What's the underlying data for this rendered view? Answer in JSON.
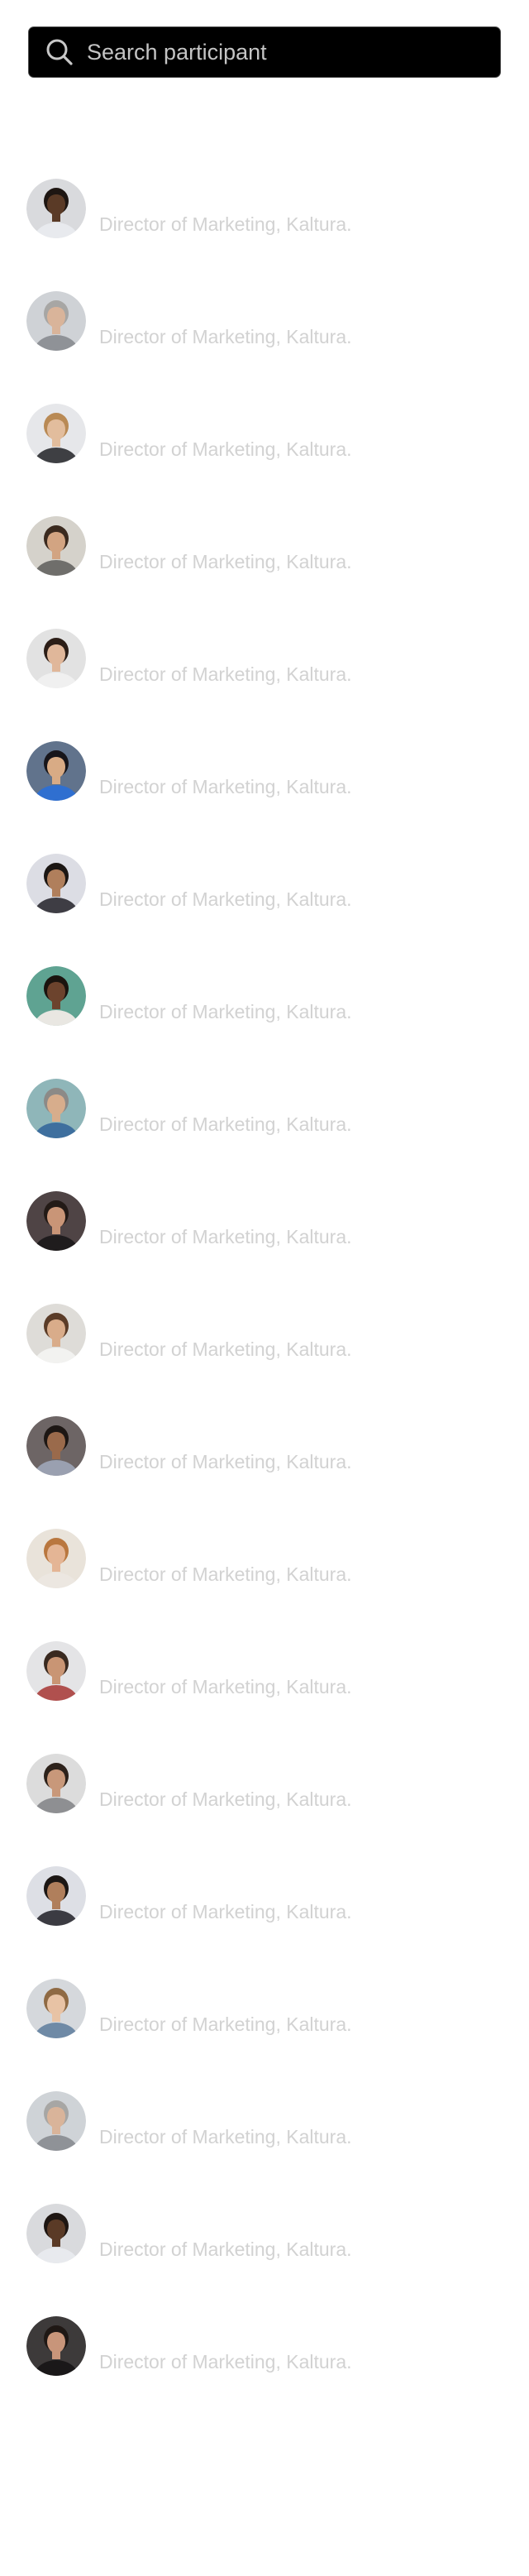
{
  "search": {
    "placeholder": "Search participant",
    "icon": "search-icon"
  },
  "colors": {
    "search_background": "#000000",
    "search_border": "#4a4a4a",
    "placeholder_text": "#c4c4c4",
    "participant_text": "#d2d2d2",
    "page_background": "#ffffff"
  },
  "participants": [
    {
      "title": "Director of Marketing, Kaltura.",
      "avatar": {
        "bg": "#d9dadd",
        "skin": "#5a3a26",
        "hair": "#1e1612",
        "shirt": "#e8eaee"
      }
    },
    {
      "title": "Director of Marketing, Kaltura.",
      "avatar": {
        "bg": "#cfd2d6",
        "skin": "#d9b49a",
        "hair": "#a7a6a4",
        "shirt": "#8f9297"
      }
    },
    {
      "title": "Director of Marketing, Kaltura.",
      "avatar": {
        "bg": "#e6e7ea",
        "skin": "#e2bd9d",
        "hair": "#b98a55",
        "shirt": "#3e3f43"
      }
    },
    {
      "title": "Director of Marketing, Kaltura.",
      "avatar": {
        "bg": "#d5d2cb",
        "skin": "#d2a482",
        "hair": "#3b2a1f",
        "shirt": "#6f6e6b"
      }
    },
    {
      "title": "Director of Marketing, Kaltura.",
      "avatar": {
        "bg": "#e2e2e2",
        "skin": "#e0b79a",
        "hair": "#2c1e17",
        "shirt": "#f0f0f0"
      }
    },
    {
      "title": "Director of Marketing, Kaltura.",
      "avatar": {
        "bg": "#61738c",
        "skin": "#d8ab85",
        "hair": "#17151a",
        "shirt": "#2f6fd0"
      }
    },
    {
      "title": "Director of Marketing, Kaltura.",
      "avatar": {
        "bg": "#dcdde4",
        "skin": "#b07f5c",
        "hair": "#1c1714",
        "shirt": "#3e3d44"
      }
    },
    {
      "title": "Director of Marketing, Kaltura.",
      "avatar": {
        "bg": "#5fa392",
        "skin": "#6c432d",
        "hair": "#1b140f",
        "shirt": "#e9e7e2"
      }
    },
    {
      "title": "Director of Marketing, Kaltura.",
      "avatar": {
        "bg": "#8fb6b9",
        "skin": "#d7ad8c",
        "hair": "#8c8a87",
        "shirt": "#3e6f9e"
      }
    },
    {
      "title": "Director of Marketing, Kaltura.",
      "avatar": {
        "bg": "#4f4445",
        "skin": "#c99577",
        "hair": "#231a16",
        "shirt": "#1f1c1d"
      }
    },
    {
      "title": "Director of Marketing, Kaltura.",
      "avatar": {
        "bg": "#dedcd8",
        "skin": "#d9ac8a",
        "hair": "#5b3c28",
        "shirt": "#f2f2f0"
      }
    },
    {
      "title": "Director of Marketing, Kaltura.",
      "avatar": {
        "bg": "#6d6565",
        "skin": "#9a6a4b",
        "hair": "#1d1714",
        "shirt": "#9aa0b0"
      }
    },
    {
      "title": "Director of Marketing, Kaltura.",
      "avatar": {
        "bg": "#e9e3da",
        "skin": "#e4b595",
        "hair": "#b9773f",
        "shirt": "#ece7e1"
      }
    },
    {
      "title": "Director of Marketing, Kaltura.",
      "avatar": {
        "bg": "#e4e4e6",
        "skin": "#c99574",
        "hair": "#3a2a20",
        "shirt": "#b0504e"
      }
    },
    {
      "title": "Director of Marketing, Kaltura.",
      "avatar": {
        "bg": "#dcdcdc",
        "skin": "#c8987a",
        "hair": "#2d221b",
        "shirt": "#8e8f92"
      }
    },
    {
      "title": "Director of Marketing, Kaltura.",
      "avatar": {
        "bg": "#dddfe5",
        "skin": "#b07f5c",
        "hair": "#1c1714",
        "shirt": "#3b3b42"
      }
    },
    {
      "title": "Director of Marketing, Kaltura.",
      "avatar": {
        "bg": "#d5d8dc",
        "skin": "#e8c3a5",
        "hair": "#8f6a44",
        "shirt": "#6f8aa6"
      }
    },
    {
      "title": "Director of Marketing, Kaltura.",
      "avatar": {
        "bg": "#cfd3d7",
        "skin": "#d9b49a",
        "hair": "#a7a6a4",
        "shirt": "#8f9297"
      }
    },
    {
      "title": "Director of Marketing, Kaltura.",
      "avatar": {
        "bg": "#d9dadd",
        "skin": "#5a3a26",
        "hair": "#1e1612",
        "shirt": "#e8eaee"
      }
    },
    {
      "title": "Director of Marketing, Kaltura.",
      "avatar": {
        "bg": "#3d3a3a",
        "skin": "#c8957a",
        "hair": "#1f1815",
        "shirt": "#1a1819"
      }
    }
  ]
}
